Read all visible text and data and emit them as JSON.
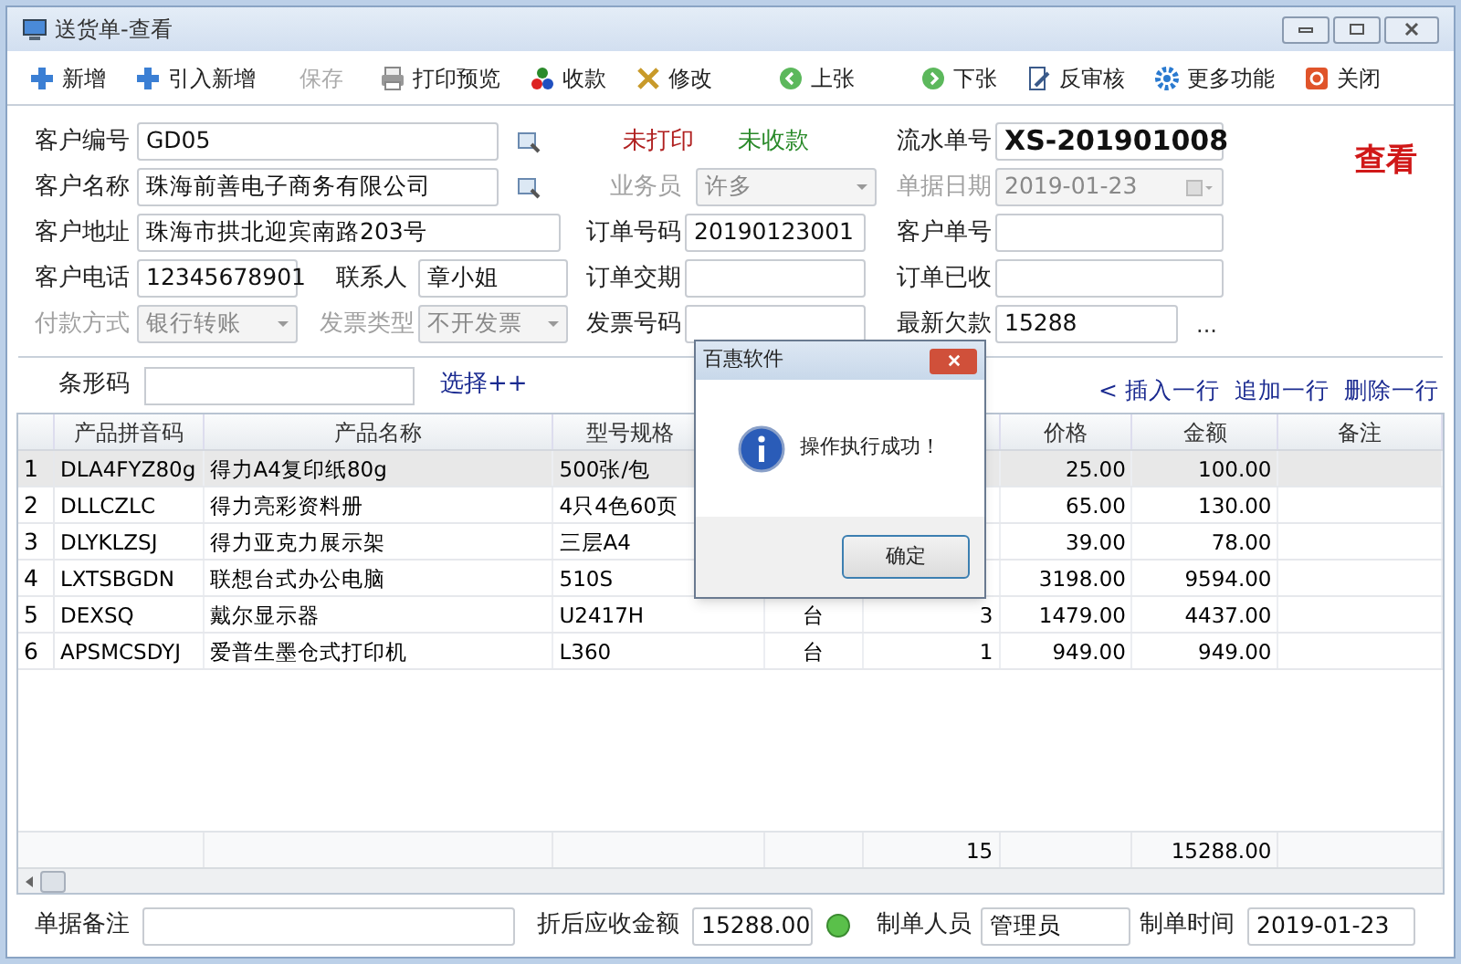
{
  "window": {
    "title": "送货单-查看"
  },
  "toolbar": [
    {
      "label": "新增",
      "kind": "plus",
      "disabled": false
    },
    {
      "label": "引入新增",
      "kind": "plus",
      "disabled": false
    },
    {
      "label": "保存",
      "kind": "none",
      "disabled": true
    },
    {
      "label": "打印预览",
      "kind": "printer",
      "disabled": false
    },
    {
      "label": "收款",
      "kind": "balls",
      "disabled": false
    },
    {
      "label": "修改",
      "kind": "tools",
      "disabled": false
    },
    {
      "label": "上张",
      "kind": "prev",
      "disabled": false
    },
    {
      "label": "下张",
      "kind": "next",
      "disabled": false
    },
    {
      "label": "反审核",
      "kind": "document",
      "disabled": false
    },
    {
      "label": "更多功能",
      "kind": "gear",
      "disabled": false
    },
    {
      "label": "关闭",
      "kind": "power",
      "disabled": false
    }
  ],
  "form": {
    "customer_code": {
      "label": "客户编号",
      "value": "GD05"
    },
    "customer_name": {
      "label": "客户名称",
      "value": "珠海前善电子商务有限公司"
    },
    "customer_address": {
      "label": "客户地址",
      "value": "珠海市拱北迎宾南路203号"
    },
    "customer_phone": {
      "label": "客户电话",
      "value": "12345678901"
    },
    "contact": {
      "label": "联系人",
      "value": "章小姐"
    },
    "payment_method": {
      "label": "付款方式",
      "value": "银行转账",
      "disabled": true
    },
    "invoice_type": {
      "label": "发票类型",
      "value": "不开发票",
      "disabled": true
    },
    "print_status": "未打印",
    "payment_status": "未收款",
    "salesperson": {
      "label": "业务员",
      "value": "许多",
      "disabled": true
    },
    "order_number": {
      "label": "订单号码",
      "value": "20190123001"
    },
    "order_delivery": {
      "label": "订单交期"
    },
    "invoice_number": {
      "label": "发票号码"
    },
    "serial_number": {
      "label": "流水单号",
      "value": "XS-201901008"
    },
    "document_date": {
      "label": "单据日期",
      "value": "2019-01-23",
      "disabled": true
    },
    "customer_order_no": {
      "label": "客户单号"
    },
    "order_received": {
      "label": "订单已收"
    },
    "latest_debt": {
      "label": "最新欠款",
      "value": "15288",
      "more": "..."
    },
    "mode": "查看"
  },
  "barcode": {
    "label": "条形码",
    "link": "选择++"
  },
  "row_actions": [
    "< 插入一行",
    "追加一行",
    "删除一行"
  ],
  "table": {
    "columns": [
      "产品拼音码",
      "产品名称",
      "型号规格",
      "价格",
      "金额",
      "备注"
    ],
    "rows": [
      {
        "index": "1",
        "code": "DLA4FYZ80g",
        "name": "得力A4复印纸80g",
        "spec": "500张/包",
        "price": "25.00",
        "amount": "100.00",
        "selected": true
      },
      {
        "index": "2",
        "code": "DLLCZLC",
        "name": "得力亮彩资料册",
        "spec": "4只4色60页",
        "price": "65.00",
        "amount": "130.00",
        "selected": false
      },
      {
        "index": "3",
        "code": "DLYKLZSJ",
        "name": "得力亚克力展示架",
        "spec": "三层A4",
        "price": "39.00",
        "amount": "78.00",
        "selected": false
      },
      {
        "index": "4",
        "code": "LXTSBGDN",
        "name": "联想台式办公电脑",
        "spec": "510S",
        "price": "3198.00",
        "amount": "9594.00",
        "selected": false
      },
      {
        "index": "5",
        "code": "DEXSQ",
        "name": "戴尔显示器",
        "spec": "U2417H",
        "column_5": "台",
        "column_6": "3",
        "price": "1479.00",
        "amount": "4437.00",
        "selected": false
      },
      {
        "index": "6",
        "code": "APSMCSDYJ",
        "name": "爱普生墨仓式打印机",
        "spec": "L360",
        "column_5": "台",
        "column_6": "1",
        "price": "949.00",
        "amount": "949.00",
        "selected": false
      }
    ],
    "totals": {
      "column_6": "15",
      "amount": "15288.00"
    }
  },
  "footer": {
    "remark": {
      "label": "单据备注"
    },
    "discounted_amount": {
      "label": "折后应收金额",
      "value": "15288.00"
    },
    "creator": {
      "label": "制单人员",
      "value": "管理员"
    },
    "created_at": {
      "label": "制单时间",
      "value": "2019-01-23"
    }
  },
  "dialog": {
    "title": "百惠软件",
    "message": "操作执行成功！",
    "button": "确定"
  }
}
